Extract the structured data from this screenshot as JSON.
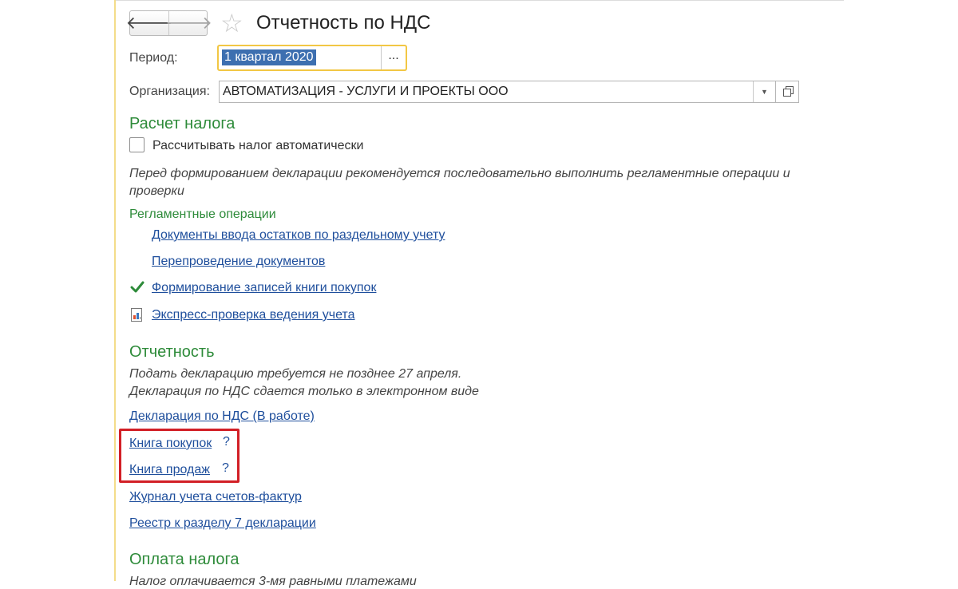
{
  "header": {
    "title": "Отчетность по НДС",
    "back_icon": "arrow-left",
    "forward_icon": "arrow-right",
    "favorite_icon": "star"
  },
  "form": {
    "period_label": "Период:",
    "period_value": "1 квартал 2020",
    "period_button": "...",
    "org_label": "Организация:",
    "org_value": "АВТОМАТИЗАЦИЯ - УСЛУГИ И ПРОЕКТЫ ООО"
  },
  "tax_calc": {
    "title": "Расчет налога",
    "auto_label": "Рассчитывать налог автоматически",
    "note": "Перед формированием декларации рекомендуется последовательно выполнить регламентные операции и проверки",
    "ops_title": "Регламентные операции",
    "ops": [
      {
        "label": "Документы ввода остатков по раздельному учету"
      },
      {
        "label": "Перепроведение документов"
      },
      {
        "label": "Формирование записей книги покупок"
      },
      {
        "label": "Экспресс-проверка ведения учета"
      }
    ]
  },
  "reporting": {
    "title": "Отчетность",
    "note_line1": "Подать декларацию требуется не позднее 27 апреля.",
    "note_line2": "Декларация по НДС сдается только в электронном виде",
    "links": [
      {
        "label": "Декларация по НДС (В работе)"
      },
      {
        "label": "Книга покупок",
        "help": "?"
      },
      {
        "label": "Книга продаж",
        "help": "?"
      },
      {
        "label": "Журнал учета счетов-фактур"
      },
      {
        "label": "Реестр к разделу 7 декларации"
      }
    ]
  },
  "payment": {
    "title": "Оплата налога",
    "note": "Налог оплачивается 3-мя равными платежами"
  },
  "colors": {
    "section_green": "#2e8b3a",
    "link_blue": "#1e4e9c",
    "highlight_red": "#d21f26",
    "focus_yellow": "#f2c744",
    "selection_blue": "#3d6fb0"
  }
}
